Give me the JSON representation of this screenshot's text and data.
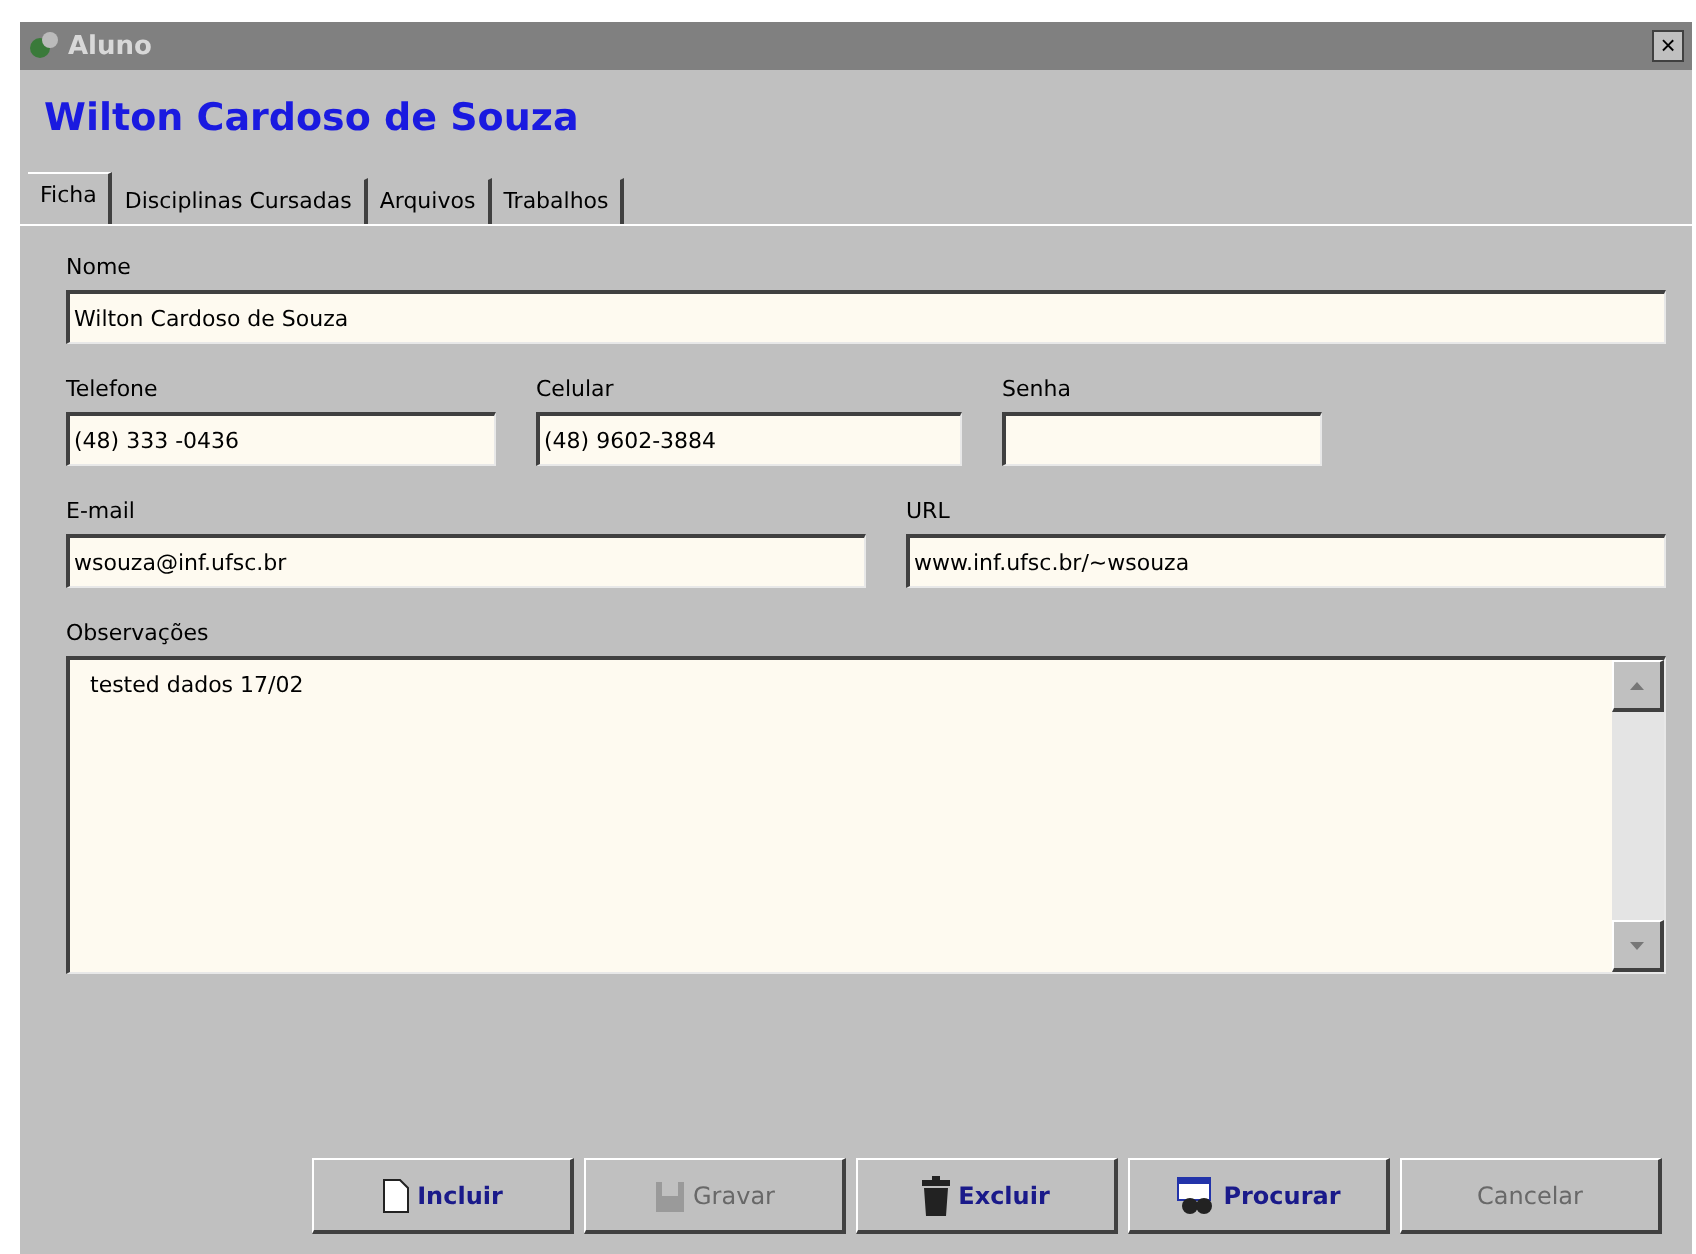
{
  "window": {
    "title": "Aluno",
    "close": "×"
  },
  "heading": "Wilton Cardoso de Souza",
  "tabs": [
    {
      "label": "Ficha",
      "selected": true
    },
    {
      "label": "Disciplinas Cursadas",
      "selected": false
    },
    {
      "label": "Arquivos",
      "selected": false
    },
    {
      "label": "Trabalhos",
      "selected": false
    }
  ],
  "fields": {
    "nome": {
      "label": "Nome",
      "value": "Wilton Cardoso de Souza"
    },
    "telefone": {
      "label": "Telefone",
      "value": "(48) 333 -0436"
    },
    "celular": {
      "label": "Celular",
      "value": "(48) 9602-3884"
    },
    "senha": {
      "label": "Senha"
    },
    "email": {
      "label": "E-mail",
      "value": "wsouza@inf.ufsc.br"
    },
    "url": {
      "label": "URL",
      "value": "www.inf.ufsc.br/~wsouza"
    },
    "observacoes": {
      "label": "Observações",
      "value": "tested dados 17/02"
    }
  },
  "buttons": [
    {
      "label": "Incluir",
      "kind": "new",
      "disabled": false
    },
    {
      "label": "Gravar",
      "kind": "save",
      "disabled": true
    },
    {
      "label": "Excluir",
      "kind": "delete",
      "disabled": false
    },
    {
      "label": "Procurar",
      "kind": "search",
      "disabled": false
    },
    {
      "label": "Cancelar",
      "kind": "none",
      "disabled": true
    }
  ]
}
